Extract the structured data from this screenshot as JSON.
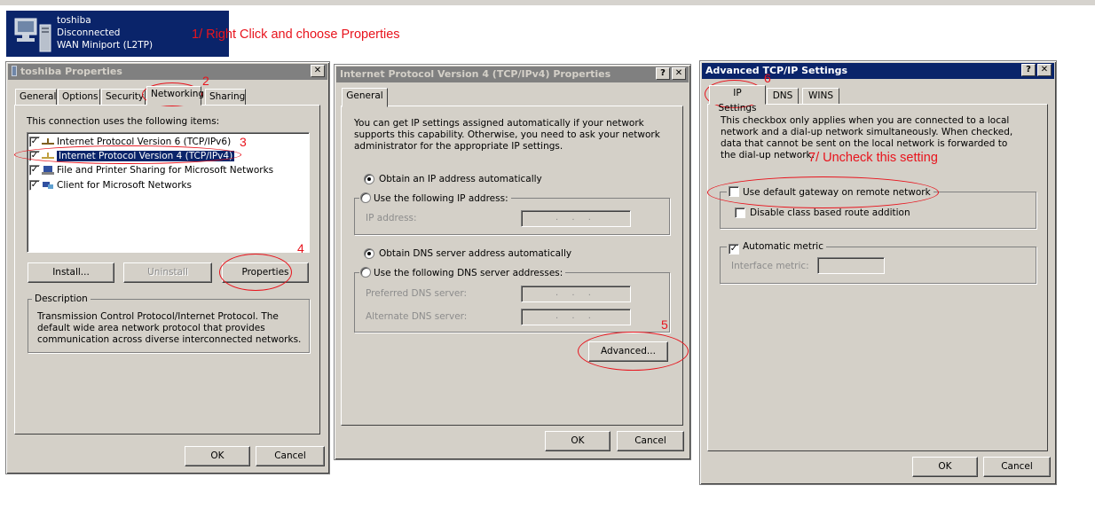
{
  "connection": {
    "name": "toshiba",
    "status": "Disconnected",
    "device": "WAN Miniport (L2TP)",
    "icon": "computer-network-icon"
  },
  "annotations": {
    "step1": "1/ Right Click and choose Properties",
    "step2": "2",
    "step3": "3",
    "step4": "4",
    "step5": "5",
    "step6": "6",
    "step7": "7/ Uncheck this setting",
    "color": "#e8141d"
  },
  "win1": {
    "title": "toshiba Properties",
    "close": "✕",
    "tabs": [
      "General",
      "Options",
      "Security",
      "Networking",
      "Sharing"
    ],
    "items_label": "This connection uses the following items:",
    "items": [
      {
        "label": "Internet Protocol Version 6 (TCP/IPv6)",
        "checked": true
      },
      {
        "label": "Internet Protocol Version 4 (TCP/IPv4)",
        "checked": true
      },
      {
        "label": "File and Printer Sharing for Microsoft Networks",
        "checked": true
      },
      {
        "label": "Client for Microsoft Networks",
        "checked": true
      }
    ],
    "install": "Install...",
    "uninstall": "Uninstall",
    "properties": "Properties",
    "description_title": "Description",
    "description": "Transmission Control Protocol/Internet Protocol. The default wide area network protocol that provides communication across diverse interconnected networks.",
    "ok": "OK",
    "cancel": "Cancel"
  },
  "win2": {
    "title": "Internet Protocol Version 4 (TCP/IPv4) Properties",
    "help": "?",
    "close": "✕",
    "tab": "General",
    "intro": "You can get IP settings assigned automatically if your network supports this capability. Otherwise, you need to ask your network administrator for the appropriate IP settings.",
    "obtain_ip": "Obtain an IP address automatically",
    "use_ip": "Use the following IP address:",
    "ip_address": "IP address:",
    "obtain_dns": "Obtain DNS server address automatically",
    "use_dns": "Use the following DNS server addresses:",
    "preferred_dns": "Preferred DNS server:",
    "alternate_dns": "Alternate DNS server:",
    "ip_placeholder": ". . .",
    "advanced": "Advanced...",
    "ok": "OK",
    "cancel": "Cancel"
  },
  "win3": {
    "title": "Advanced TCP/IP Settings",
    "help": "?",
    "close": "✕",
    "tabs": [
      "IP Settings",
      "DNS",
      "WINS"
    ],
    "info": "This checkbox only applies when you are connected to a local network and a dial-up network simultaneously.  When checked, data that cannot be sent on the local network is forwarded to the dial-up network.",
    "use_default_gateway": "Use default gateway on remote network",
    "disable_class_route": "Disable class based route addition",
    "automatic_metric": "Automatic metric",
    "interface_metric": "Interface metric:",
    "ok": "OK",
    "cancel": "Cancel"
  }
}
